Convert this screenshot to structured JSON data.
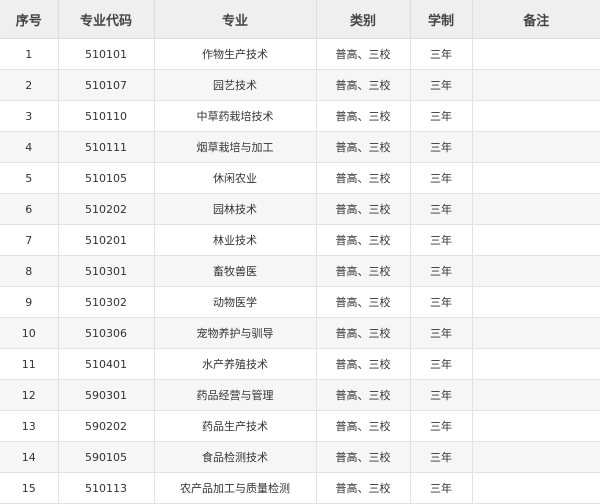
{
  "table": {
    "headers": [
      "序号",
      "专业代码",
      "专业",
      "类别",
      "学制",
      "备注"
    ],
    "rows": [
      {
        "no": "1",
        "code": "510101",
        "name": "作物生产技术",
        "category": "普高、三校",
        "duration": "三年",
        "note": ""
      },
      {
        "no": "2",
        "code": "510107",
        "name": "园艺技术",
        "category": "普高、三校",
        "duration": "三年",
        "note": ""
      },
      {
        "no": "3",
        "code": "510110",
        "name": "中草药栽培技术",
        "category": "普高、三校",
        "duration": "三年",
        "note": ""
      },
      {
        "no": "4",
        "code": "510111",
        "name": "烟草栽培与加工",
        "category": "普高、三校",
        "duration": "三年",
        "note": ""
      },
      {
        "no": "5",
        "code": "510105",
        "name": "休闲农业",
        "category": "普高、三校",
        "duration": "三年",
        "note": ""
      },
      {
        "no": "6",
        "code": "510202",
        "name": "园林技术",
        "category": "普高、三校",
        "duration": "三年",
        "note": ""
      },
      {
        "no": "7",
        "code": "510201",
        "name": "林业技术",
        "category": "普高、三校",
        "duration": "三年",
        "note": ""
      },
      {
        "no": "8",
        "code": "510301",
        "name": "畜牧兽医",
        "category": "普高、三校",
        "duration": "三年",
        "note": ""
      },
      {
        "no": "9",
        "code": "510302",
        "name": "动物医学",
        "category": "普高、三校",
        "duration": "三年",
        "note": ""
      },
      {
        "no": "10",
        "code": "510306",
        "name": "宠物养护与驯导",
        "category": "普高、三校",
        "duration": "三年",
        "note": ""
      },
      {
        "no": "11",
        "code": "510401",
        "name": "水产养殖技术",
        "category": "普高、三校",
        "duration": "三年",
        "note": ""
      },
      {
        "no": "12",
        "code": "590301",
        "name": "药品经营与管理",
        "category": "普高、三校",
        "duration": "三年",
        "note": ""
      },
      {
        "no": "13",
        "code": "590202",
        "name": "药品生产技术",
        "category": "普高、三校",
        "duration": "三年",
        "note": ""
      },
      {
        "no": "14",
        "code": "590105",
        "name": "食品检测技术",
        "category": "普高、三校",
        "duration": "三年",
        "note": ""
      },
      {
        "no": "15",
        "code": "510113",
        "name": "农产品加工与质量检测",
        "category": "普高、三校",
        "duration": "三年",
        "note": ""
      }
    ]
  },
  "colors": {
    "header_bg": "#efefef",
    "row_alt_bg": "#f6f6f6",
    "row_bg": "#ffffff",
    "border": "#e2e2e2",
    "text": "#333333"
  }
}
